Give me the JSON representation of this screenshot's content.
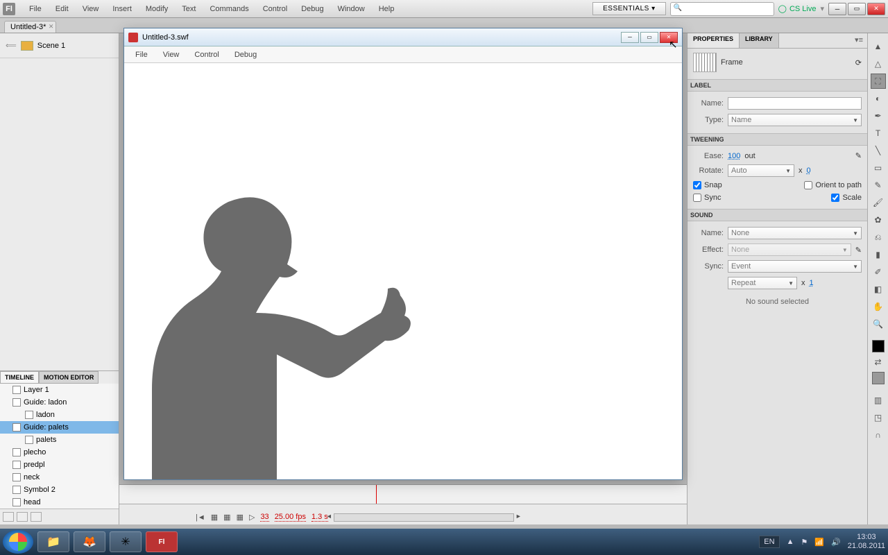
{
  "menubar": {
    "items": [
      "File",
      "Edit",
      "View",
      "Insert",
      "Modify",
      "Text",
      "Commands",
      "Control",
      "Debug",
      "Window",
      "Help"
    ],
    "workspace": "ESSENTIALS ▾",
    "cslive": "CS Live"
  },
  "doc_tab": {
    "label": "Untitled-3*"
  },
  "scene": {
    "label": "Scene 1"
  },
  "left_tabs": {
    "timeline": "TIMELINE",
    "motion": "MOTION EDITOR"
  },
  "layers": [
    {
      "name": "Layer 1",
      "sub": false,
      "sel": false
    },
    {
      "name": "Guide: ladon",
      "sub": false,
      "sel": false
    },
    {
      "name": "ladon",
      "sub": true,
      "sel": false
    },
    {
      "name": "Guide: palets",
      "sub": false,
      "sel": true
    },
    {
      "name": "palets",
      "sub": true,
      "sel": false
    },
    {
      "name": "plecho",
      "sub": false,
      "sel": false
    },
    {
      "name": "predpl",
      "sub": false,
      "sel": false
    },
    {
      "name": "neck",
      "sub": false,
      "sel": false
    },
    {
      "name": "Symbol 2",
      "sub": false,
      "sel": false
    },
    {
      "name": "head",
      "sub": false,
      "sel": false
    }
  ],
  "tl": {
    "frame": "33",
    "fps": "25.00 fps",
    "secs": "1.3 s"
  },
  "right": {
    "tabs": {
      "props": "PROPERTIES",
      "library": "LIBRARY"
    },
    "frame_label": "Frame",
    "sections": {
      "label": "LABEL",
      "tween": "TWEENING",
      "sound": "SOUND"
    },
    "name_lbl": "Name:",
    "type_lbl": "Type:",
    "type_val": "Name",
    "ease_lbl": "Ease:",
    "ease_val": "100",
    "ease_out": "out",
    "rotate_lbl": "Rotate:",
    "rotate_val": "Auto",
    "rotate_x": "x",
    "rotate_times": "0",
    "snap": "Snap",
    "orient": "Orient to path",
    "sync": "Sync",
    "scale": "Scale",
    "s_name": "Name:",
    "s_name_v": "None",
    "s_effect": "Effect:",
    "s_effect_v": "None",
    "s_sync": "Sync:",
    "s_sync_v": "Event",
    "s_repeat": "Repeat",
    "s_repeat_x": "x",
    "s_repeat_n": "1",
    "no_sound": "No sound selected"
  },
  "swf": {
    "title": "Untitled-3.swf",
    "menus": [
      "File",
      "View",
      "Control",
      "Debug"
    ]
  },
  "taskbar": {
    "lang": "EN",
    "time": "13:03",
    "date": "21.08.2011"
  }
}
